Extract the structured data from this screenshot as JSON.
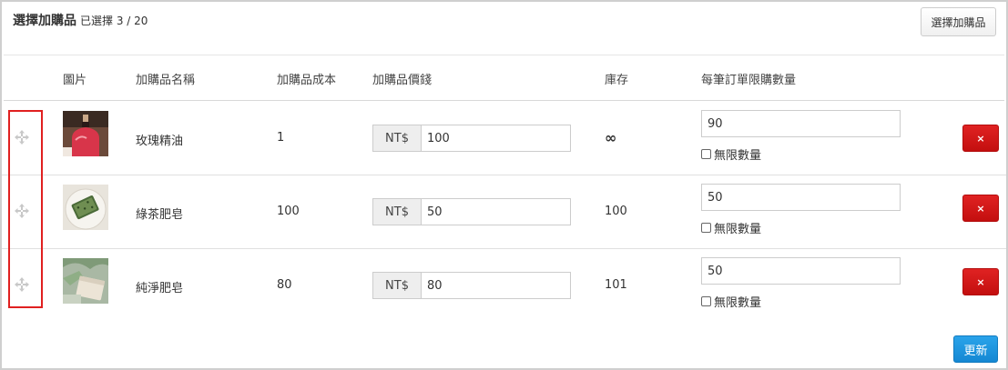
{
  "header": {
    "title": "選擇加購品",
    "selected_info": "已選擇 3 / 20",
    "choose_button": "選擇加購品"
  },
  "columns": {
    "image": "圖片",
    "name": "加購品名稱",
    "cost": "加購品成本",
    "price": "加購品價錢",
    "stock": "庫存",
    "limit": "每筆訂單限購數量"
  },
  "rows": [
    {
      "name": "玫瑰精油",
      "cost": "1",
      "currency": "NT$",
      "price": "100",
      "stock": "∞",
      "limit": "90",
      "unlimited_label": "無限數量",
      "image_icon": "rose-oil-bottle-image"
    },
    {
      "name": "綠茶肥皂",
      "cost": "100",
      "currency": "NT$",
      "price": "50",
      "stock": "100",
      "limit": "50",
      "unlimited_label": "無限數量",
      "image_icon": "green-tea-soap-image"
    },
    {
      "name": "純淨肥皂",
      "cost": "80",
      "currency": "NT$",
      "price": "80",
      "stock": "101",
      "limit": "50",
      "unlimited_label": "無限數量",
      "image_icon": "pure-soap-image"
    }
  ],
  "delete_label": "×",
  "update_button": "更新",
  "colors": {
    "delete": "#d41818",
    "update": "#1a93de",
    "highlight": "#e02020"
  }
}
